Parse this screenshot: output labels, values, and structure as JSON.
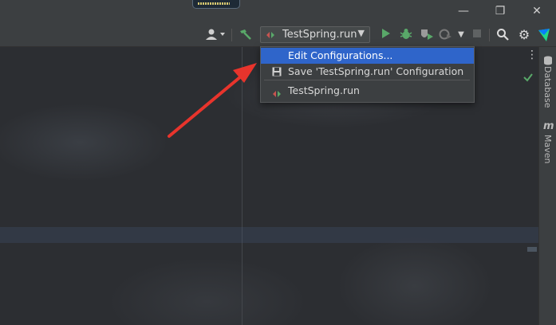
{
  "window": {
    "minimize_glyph": "—",
    "restore_glyph": "❐",
    "close_glyph": "✕"
  },
  "toolbar": {
    "run_config_label": "TestSpring.run",
    "icons": [
      "user-icon",
      "build-hammer-icon",
      "run-icon",
      "debug-icon",
      "coverage-icon",
      "profile-icon",
      "stop-icon",
      "search-icon",
      "settings-icon",
      "toolbox-icon",
      "more-vertical-icon"
    ]
  },
  "run_menu": {
    "items": [
      {
        "label": "Edit Configurations...",
        "selected": true
      },
      {
        "label": "Save 'TestSpring.run' Configuration",
        "selected": false
      },
      {
        "label": "TestSpring.run",
        "selected": false
      }
    ]
  },
  "right_panel": {
    "database_label": "Database",
    "maven_label": "Maven"
  },
  "colors": {
    "selection": "#2f65ca",
    "run_green": "#59a869",
    "annotation_arrow": "#e8342c"
  }
}
